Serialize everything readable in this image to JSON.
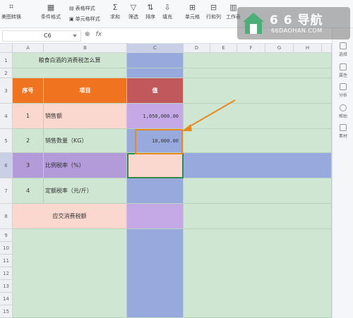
{
  "ribbon": {
    "items": [
      {
        "label": "美图转换",
        "icon": "crop-icon"
      },
      {
        "label": "条件格式",
        "icon": "grid-icon"
      },
      {
        "label": "表格样式",
        "icon": "table-style-icon"
      },
      {
        "label": "单元格样式",
        "icon": "cell-style-icon"
      },
      {
        "label": "求和",
        "icon": "sum-icon"
      },
      {
        "label": "筛选",
        "icon": "filter-icon"
      },
      {
        "label": "排序",
        "icon": "sort-icon"
      },
      {
        "label": "填充",
        "icon": "fill-icon"
      },
      {
        "label": "单元格",
        "icon": "cell-icon"
      },
      {
        "label": "行和列",
        "icon": "row-col-icon"
      },
      {
        "label": "工作表",
        "icon": "sheet-icon"
      }
    ]
  },
  "formula_bar": {
    "name_box": "C6",
    "fx": "fx"
  },
  "columns": [
    "A",
    "B",
    "C",
    "D",
    "E",
    "F",
    "G",
    "H"
  ],
  "rows": [
    "1",
    "2",
    "3",
    "4",
    "5",
    "6",
    "7",
    "8",
    "9",
    "10",
    "11",
    "12",
    "13",
    "14",
    "15"
  ],
  "sheet": {
    "title": "粮食白酒的消费税怎么算",
    "headers": {
      "no": "序号",
      "item": "项目",
      "value": "值"
    },
    "data_rows": [
      {
        "no": "1",
        "item": "销售额",
        "value": "1,050,000.00"
      },
      {
        "no": "2",
        "item": "销售数量（KG）",
        "value": "10,000.00"
      },
      {
        "no": "3",
        "item": "比例税率（%）",
        "value": ""
      },
      {
        "no": "4",
        "item": "定额税率（元/斤）",
        "value": ""
      },
      {
        "no": "",
        "item": "应交消费税额",
        "value": ""
      }
    ]
  },
  "sidebar": {
    "items": [
      {
        "label": "选择",
        "icon": "cursor-icon"
      },
      {
        "label": "属性",
        "icon": "property-icon"
      },
      {
        "label": "分析",
        "icon": "analysis-icon"
      },
      {
        "label": "帮助",
        "icon": "help-icon"
      },
      {
        "label": "素材",
        "icon": "material-icon"
      }
    ]
  },
  "watermark": {
    "main": "6 6 导航",
    "sub": "66DAOHAN.COM"
  },
  "colors": {
    "orange": "#f0731f",
    "red": "#c0585c",
    "blue": "#98a9dd",
    "green": "#cfe6d2",
    "pink": "#fbd8cf",
    "purple": "#b39ad8"
  }
}
